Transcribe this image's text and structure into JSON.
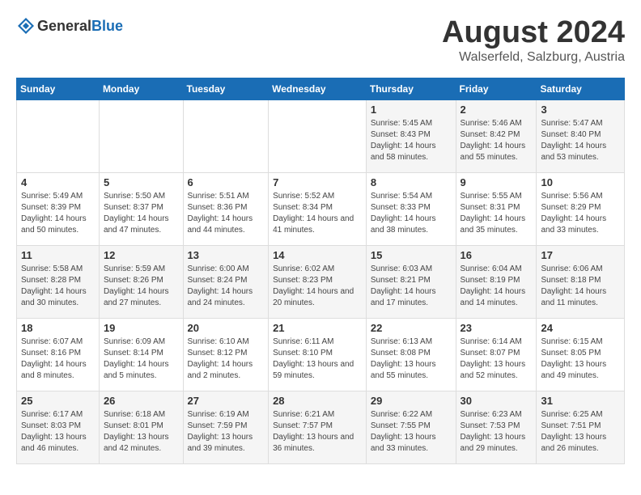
{
  "logo": {
    "general": "General",
    "blue": "Blue"
  },
  "title": "August 2024",
  "subtitle": "Walserfeld, Salzburg, Austria",
  "days_of_week": [
    "Sunday",
    "Monday",
    "Tuesday",
    "Wednesday",
    "Thursday",
    "Friday",
    "Saturday"
  ],
  "weeks": [
    [
      {
        "day": "",
        "info": ""
      },
      {
        "day": "",
        "info": ""
      },
      {
        "day": "",
        "info": ""
      },
      {
        "day": "",
        "info": ""
      },
      {
        "day": "1",
        "info": "Sunrise: 5:45 AM\nSunset: 8:43 PM\nDaylight: 14 hours\nand 58 minutes."
      },
      {
        "day": "2",
        "info": "Sunrise: 5:46 AM\nSunset: 8:42 PM\nDaylight: 14 hours\nand 55 minutes."
      },
      {
        "day": "3",
        "info": "Sunrise: 5:47 AM\nSunset: 8:40 PM\nDaylight: 14 hours\nand 53 minutes."
      }
    ],
    [
      {
        "day": "4",
        "info": "Sunrise: 5:49 AM\nSunset: 8:39 PM\nDaylight: 14 hours\nand 50 minutes."
      },
      {
        "day": "5",
        "info": "Sunrise: 5:50 AM\nSunset: 8:37 PM\nDaylight: 14 hours\nand 47 minutes."
      },
      {
        "day": "6",
        "info": "Sunrise: 5:51 AM\nSunset: 8:36 PM\nDaylight: 14 hours\nand 44 minutes."
      },
      {
        "day": "7",
        "info": "Sunrise: 5:52 AM\nSunset: 8:34 PM\nDaylight: 14 hours\nand 41 minutes."
      },
      {
        "day": "8",
        "info": "Sunrise: 5:54 AM\nSunset: 8:33 PM\nDaylight: 14 hours\nand 38 minutes."
      },
      {
        "day": "9",
        "info": "Sunrise: 5:55 AM\nSunset: 8:31 PM\nDaylight: 14 hours\nand 35 minutes."
      },
      {
        "day": "10",
        "info": "Sunrise: 5:56 AM\nSunset: 8:29 PM\nDaylight: 14 hours\nand 33 minutes."
      }
    ],
    [
      {
        "day": "11",
        "info": "Sunrise: 5:58 AM\nSunset: 8:28 PM\nDaylight: 14 hours\nand 30 minutes."
      },
      {
        "day": "12",
        "info": "Sunrise: 5:59 AM\nSunset: 8:26 PM\nDaylight: 14 hours\nand 27 minutes."
      },
      {
        "day": "13",
        "info": "Sunrise: 6:00 AM\nSunset: 8:24 PM\nDaylight: 14 hours\nand 24 minutes."
      },
      {
        "day": "14",
        "info": "Sunrise: 6:02 AM\nSunset: 8:23 PM\nDaylight: 14 hours\nand 20 minutes."
      },
      {
        "day": "15",
        "info": "Sunrise: 6:03 AM\nSunset: 8:21 PM\nDaylight: 14 hours\nand 17 minutes."
      },
      {
        "day": "16",
        "info": "Sunrise: 6:04 AM\nSunset: 8:19 PM\nDaylight: 14 hours\nand 14 minutes."
      },
      {
        "day": "17",
        "info": "Sunrise: 6:06 AM\nSunset: 8:18 PM\nDaylight: 14 hours\nand 11 minutes."
      }
    ],
    [
      {
        "day": "18",
        "info": "Sunrise: 6:07 AM\nSunset: 8:16 PM\nDaylight: 14 hours\nand 8 minutes."
      },
      {
        "day": "19",
        "info": "Sunrise: 6:09 AM\nSunset: 8:14 PM\nDaylight: 14 hours\nand 5 minutes."
      },
      {
        "day": "20",
        "info": "Sunrise: 6:10 AM\nSunset: 8:12 PM\nDaylight: 14 hours\nand 2 minutes."
      },
      {
        "day": "21",
        "info": "Sunrise: 6:11 AM\nSunset: 8:10 PM\nDaylight: 13 hours\nand 59 minutes."
      },
      {
        "day": "22",
        "info": "Sunrise: 6:13 AM\nSunset: 8:08 PM\nDaylight: 13 hours\nand 55 minutes."
      },
      {
        "day": "23",
        "info": "Sunrise: 6:14 AM\nSunset: 8:07 PM\nDaylight: 13 hours\nand 52 minutes."
      },
      {
        "day": "24",
        "info": "Sunrise: 6:15 AM\nSunset: 8:05 PM\nDaylight: 13 hours\nand 49 minutes."
      }
    ],
    [
      {
        "day": "25",
        "info": "Sunrise: 6:17 AM\nSunset: 8:03 PM\nDaylight: 13 hours\nand 46 minutes."
      },
      {
        "day": "26",
        "info": "Sunrise: 6:18 AM\nSunset: 8:01 PM\nDaylight: 13 hours\nand 42 minutes."
      },
      {
        "day": "27",
        "info": "Sunrise: 6:19 AM\nSunset: 7:59 PM\nDaylight: 13 hours\nand 39 minutes."
      },
      {
        "day": "28",
        "info": "Sunrise: 6:21 AM\nSunset: 7:57 PM\nDaylight: 13 hours\nand 36 minutes."
      },
      {
        "day": "29",
        "info": "Sunrise: 6:22 AM\nSunset: 7:55 PM\nDaylight: 13 hours\nand 33 minutes."
      },
      {
        "day": "30",
        "info": "Sunrise: 6:23 AM\nSunset: 7:53 PM\nDaylight: 13 hours\nand 29 minutes."
      },
      {
        "day": "31",
        "info": "Sunrise: 6:25 AM\nSunset: 7:51 PM\nDaylight: 13 hours\nand 26 minutes."
      }
    ]
  ]
}
